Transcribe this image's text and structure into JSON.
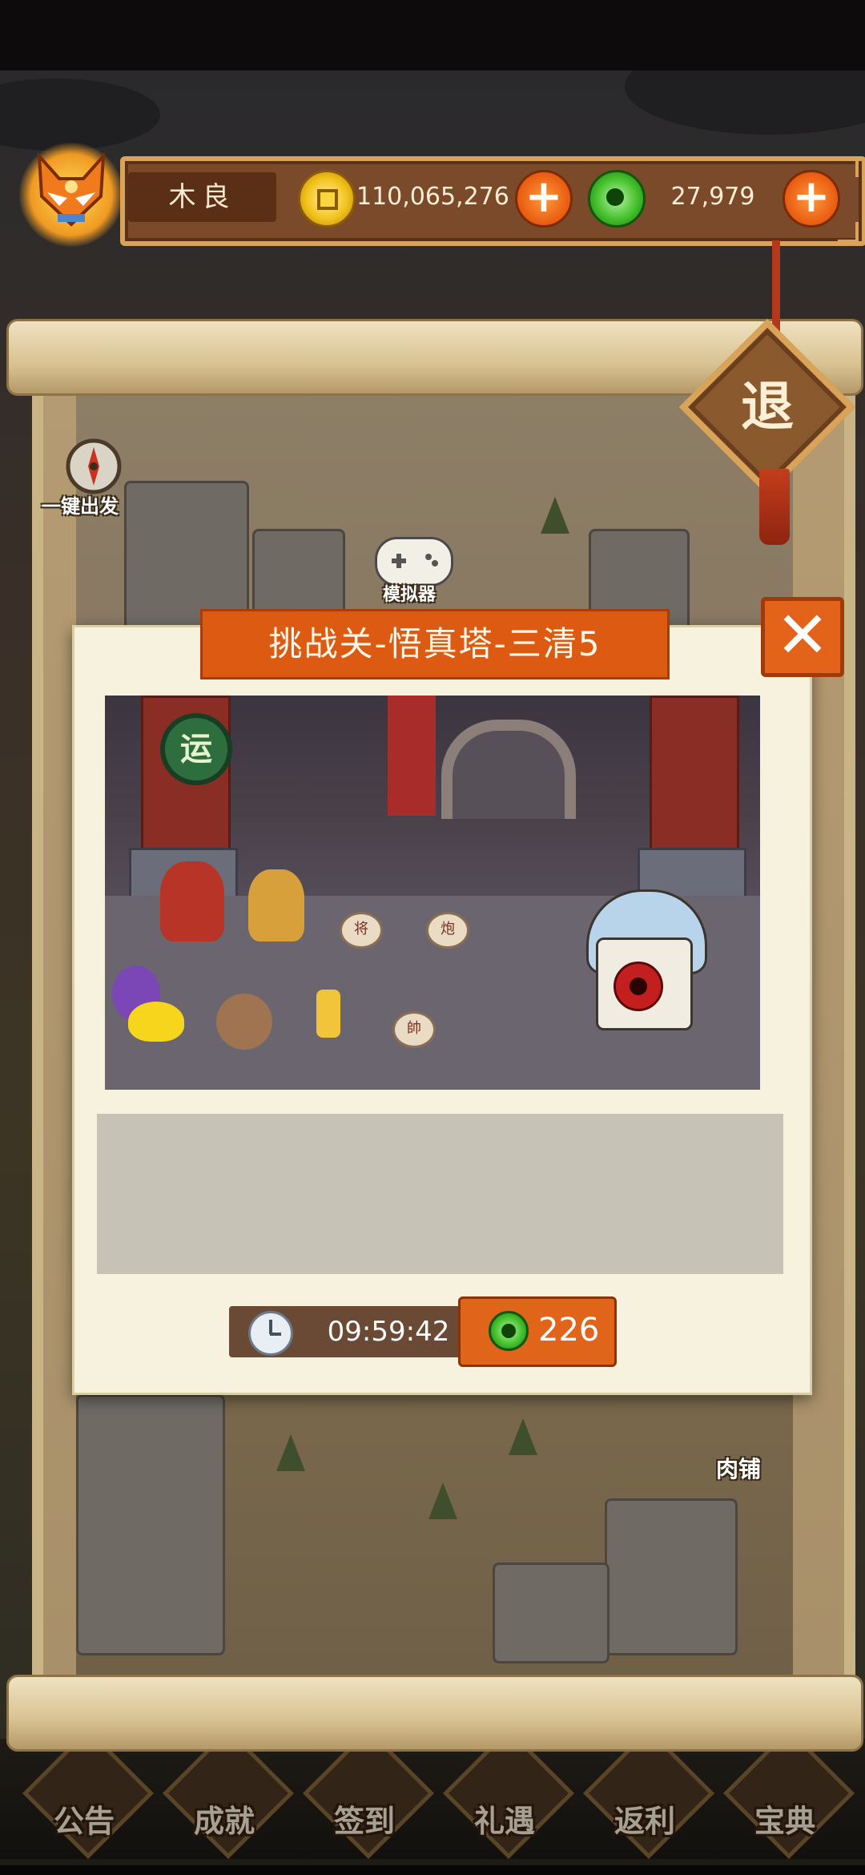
{
  "player": {
    "name": "木良"
  },
  "resources": {
    "gold": "110,065,276",
    "jade": "27,979"
  },
  "map": {
    "auto_depart_label": "一键出发",
    "emulator_label": "模拟器",
    "butcher_label": "肉铺"
  },
  "exit": {
    "label": "退"
  },
  "dialog": {
    "title": "挑战关-悟真塔-三清5",
    "badge_char": "运",
    "pieces": [
      "将",
      "炮",
      "帥"
    ],
    "timer": "09:59:42",
    "cost": "226"
  },
  "bottom_menu": [
    {
      "label": "公告"
    },
    {
      "label": "成就"
    },
    {
      "label": "签到"
    },
    {
      "label": "礼遇"
    },
    {
      "label": "返利"
    },
    {
      "label": "宝典"
    }
  ],
  "colors": {
    "accent_orange": "#dd5a12",
    "frame_gold": "#d9a45a",
    "wood_brown": "#7a4a2a",
    "parchment": "#f7f2de",
    "jade_green": "#45c12d"
  }
}
